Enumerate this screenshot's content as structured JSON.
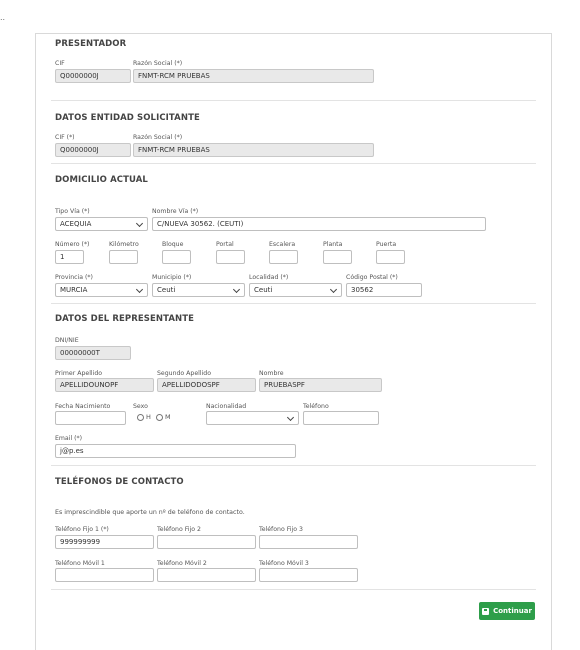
{
  "topbar": {
    "dots": ".."
  },
  "presentador": {
    "heading": "PRESENTADOR",
    "cif_label": "CIF",
    "cif_value": "Q0000000J",
    "razon_label": "Razón Social (*)",
    "razon_value": "FNMT-RCM PRUEBAS"
  },
  "solicitante": {
    "heading": "DATOS ENTIDAD SOLICITANTE",
    "cif_label": "CIF (*)",
    "cif_value": "Q0000000J",
    "razon_label": "Razón Social (*)",
    "razon_value": "FNMT-RCM PRUEBAS"
  },
  "domicilio": {
    "heading": "DOMICILIO ACTUAL",
    "tipo_via_label": "Tipo Vía (*)",
    "tipo_via_value": "ACEQUIA",
    "nombre_via_label": "Nombre Vía (*)",
    "nombre_via_value": "C/NUEVA  30562. (CEUTI)",
    "numero_label": "Número (*)",
    "numero_value": "1",
    "kilometro_label": "Kilómetro",
    "bloque_label": "Bloque",
    "portal_label": "Portal",
    "escalera_label": "Escalera",
    "planta_label": "Planta",
    "puerta_label": "Puerta",
    "provincia_label": "Provincia (*)",
    "provincia_value": "MURCIA",
    "municipio_label": "Municipio (*)",
    "municipio_value": "Ceuti",
    "localidad_label": "Localidad (*)",
    "localidad_value": "Ceuti",
    "cp_label": "Código Postal (*)",
    "cp_value": "30562"
  },
  "representante": {
    "heading": "DATOS DEL REPRESENTANTE",
    "dni_label": "DNI/NIE",
    "dni_value": "00000000T",
    "primer_label": "Primer Apellido",
    "primer_value": "APELLIDOUNOPF",
    "segundo_label": "Segundo Apellido",
    "segundo_value": "APELLIDODOSPF",
    "nombre_label": "Nombre",
    "nombre_value": "PRUEBASPF",
    "fecha_label": "Fecha Nacimiento",
    "sexo_label": "Sexo",
    "sexo_h": "H",
    "sexo_m": "M",
    "nacionalidad_label": "Nacionalidad",
    "telefono_label": "Teléfono",
    "email_label": "Email (*)",
    "email_value": "j@p.es"
  },
  "telefonos": {
    "heading": "TELÉFONOS DE CONTACTO",
    "note": "Es imprescindible que aporte un nº de teléfono de contacto.",
    "fijo1_label": "Teléfono Fijo 1 (*)",
    "fijo1_value": "999999999",
    "fijo2_label": "Teléfono Fijo 2",
    "fijo3_label": "Teléfono Fijo 3",
    "movil1_label": "Teléfono Móvil 1",
    "movil2_label": "Teléfono Móvil 2",
    "movil3_label": "Teléfono Móvil 3"
  },
  "actions": {
    "continuar_label": "Continuar"
  }
}
